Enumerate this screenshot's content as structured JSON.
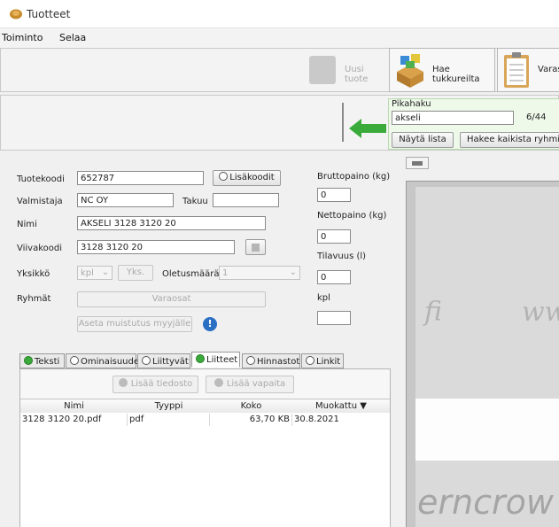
{
  "window": {
    "title": "Tuotteet"
  },
  "menu": [
    "Toiminto",
    "Selaa"
  ],
  "toolbar": {
    "new_product_label": "Uusi tuote",
    "fetch_wholesalers_label": "Hae tukkureilta",
    "inventory_label": "Varas"
  },
  "quicksearch": {
    "legend": "Pikahaku",
    "value": "akseli",
    "count": "6/44",
    "show_list_label": "Näytä lista",
    "search_all_label": "Hakee kaikista ryhmistä"
  },
  "product": {
    "code_label": "Tuotekoodi",
    "code_value": "652787",
    "extra_codes_label": "Lisäkoodit",
    "manufacturer_label": "Valmistaja",
    "manufacturer_value": "NC OY",
    "warranty_label": "Takuu",
    "warranty_value": "",
    "name_label": "Nimi",
    "name_value": "AKSELI 3128 3120 20",
    "barcode_label": "Viivakoodi",
    "barcode_value": "3128 3120 20",
    "unit_label": "Yksikkö",
    "unit_value": "kpl",
    "unit_button_label": "Yks.",
    "default_qty_label": "Oletusmäärä",
    "default_qty_value": "1",
    "groups_label": "Ryhmät",
    "groups_button_label": "Varaosat",
    "reminder_button_label": "Aseta muistutus myyjälle",
    "gross_weight_label": "Bruttopaino (kg)",
    "gross_weight_value": "0",
    "net_weight_label": "Nettopaino (kg)",
    "net_weight_value": "0",
    "volume_label": "Tilavuus (l)",
    "volume_value": "0",
    "pcs_label": "kpl",
    "pcs_value": ""
  },
  "tabs": [
    {
      "label": "Teksti"
    },
    {
      "label": "Ominaisuudet"
    },
    {
      "label": "Liittyvät"
    },
    {
      "label": "Liitteet"
    },
    {
      "label": "Hinnastot"
    },
    {
      "label": "Linkit"
    }
  ],
  "attachments": {
    "add_file_label": "Lisää tiedosto",
    "add_free_label": "Lisää vapaita",
    "columns": [
      "Nimi",
      "Tyyppi",
      "Koko",
      "Muokattu ▼"
    ],
    "rows": [
      {
        "name": "3128 3120 20.pdf",
        "type": "pdf",
        "size": "63,70 KB",
        "modified": "30.8.2021"
      }
    ]
  },
  "preview": {
    "text_top_left": "fi",
    "text_top_right": "ww",
    "text_bottom": "erncrow"
  },
  "colors": {
    "accent_green": "#3aab3a",
    "quicksearch_bg": "#eef9ea"
  }
}
